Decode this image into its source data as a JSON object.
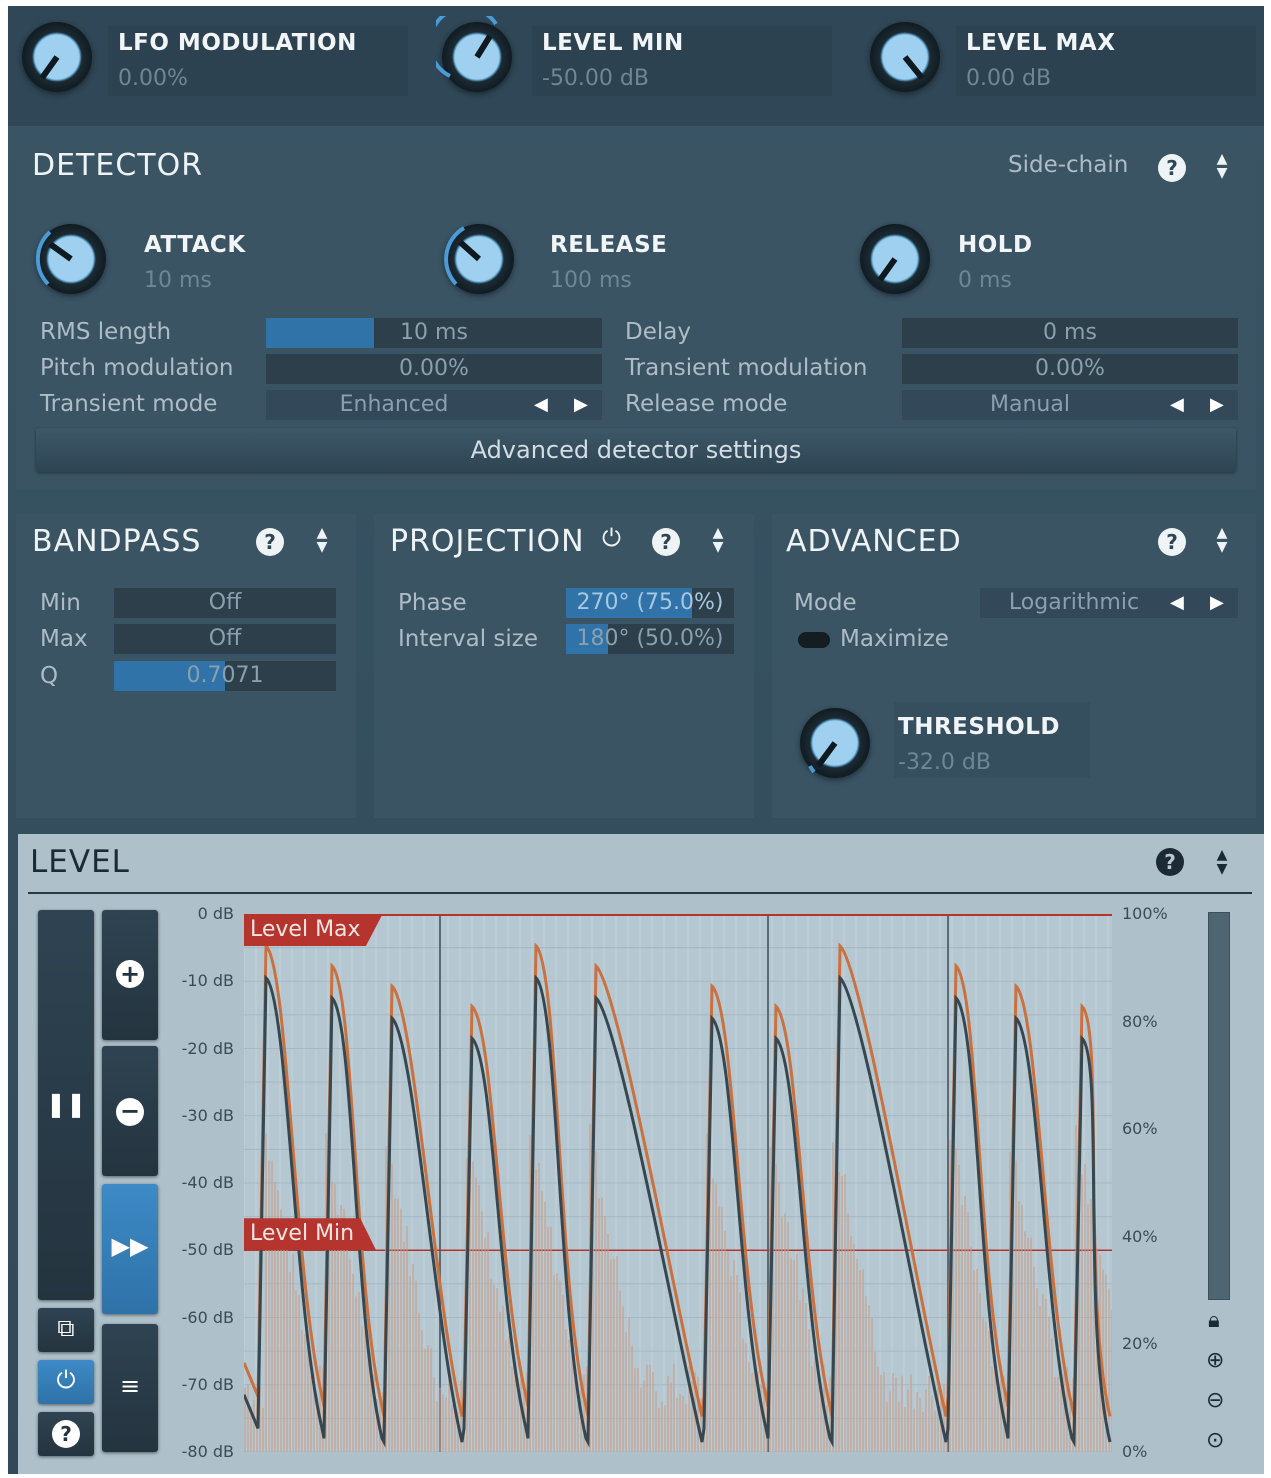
{
  "top": {
    "lfo": {
      "title": "LFO MODULATION",
      "value": "0.00%"
    },
    "level_min": {
      "title": "LEVEL MIN",
      "value": "-50.00 dB"
    },
    "level_max": {
      "title": "LEVEL MAX",
      "value": "0.00 dB"
    }
  },
  "detector": {
    "title": "DETECTOR",
    "sidechain_label": "Side-chain",
    "help": "?",
    "attack": {
      "title": "ATTACK",
      "value": "10 ms"
    },
    "release": {
      "title": "RELEASE",
      "value": "100 ms"
    },
    "hold": {
      "title": "HOLD",
      "value": "0 ms"
    },
    "rms_length": {
      "label": "RMS length",
      "value": "10 ms",
      "fill": 0.32
    },
    "pitch_mod": {
      "label": "Pitch modulation",
      "value": "0.00%"
    },
    "transient_mode": {
      "label": "Transient mode",
      "value": "Enhanced"
    },
    "delay": {
      "label": "Delay",
      "value": "0 ms"
    },
    "transient_mod": {
      "label": "Transient modulation",
      "value": "0.00%"
    },
    "release_mode": {
      "label": "Release mode",
      "value": "Manual"
    },
    "advanced_button": "Advanced detector settings"
  },
  "bandpass": {
    "title": "BANDPASS",
    "help": "?",
    "min": {
      "label": "Min",
      "value": "Off"
    },
    "max": {
      "label": "Max",
      "value": "Off"
    },
    "q": {
      "label": "Q",
      "value": "0.7071",
      "fill": 0.5
    }
  },
  "projection": {
    "title": "PROJECTION",
    "help": "?",
    "phase": {
      "label": "Phase",
      "value": "270° (75.0%)",
      "fill": 0.75
    },
    "interval": {
      "label": "Interval size",
      "value": "180° (50.0%)",
      "fill": 0.25
    }
  },
  "advanced": {
    "title": "ADVANCED",
    "help": "?",
    "mode": {
      "label": "Mode",
      "value": "Logarithmic"
    },
    "maximize": "Maximize",
    "threshold": {
      "title": "THRESHOLD",
      "value": "-32.0 dB"
    }
  },
  "level": {
    "title": "LEVEL",
    "help": "?",
    "level_max_tag": "Level Max",
    "level_min_tag": "Level Min",
    "db_labels": [
      "0 dB",
      "-10 dB",
      "-20 dB",
      "-30 dB",
      "-40 dB",
      "-50 dB",
      "-60 dB",
      "-70 dB",
      "-80 dB"
    ],
    "pct_labels": [
      "100%",
      "80%",
      "60%",
      "40%",
      "20%",
      "0%"
    ],
    "level_max_db": 0,
    "level_min_db": -50
  },
  "colors": {
    "accent": "#2f73a9",
    "orange": "#c9713f",
    "dark_line": "#37474f",
    "tag_red": "#b5352e"
  }
}
